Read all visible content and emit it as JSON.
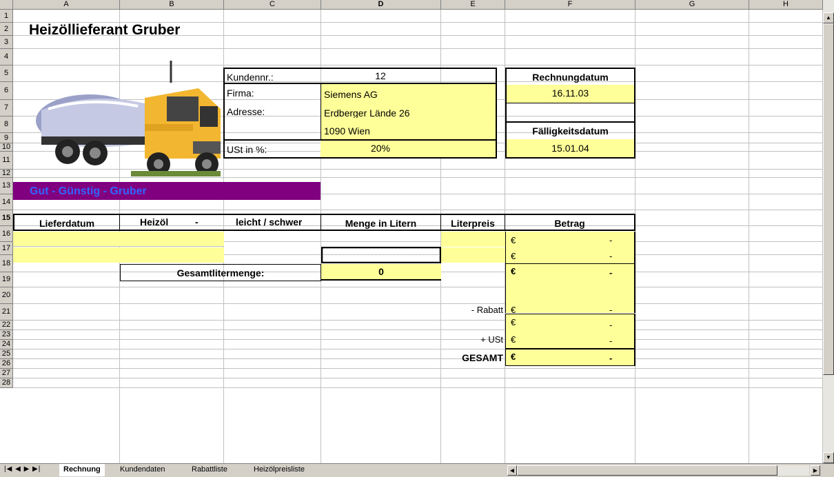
{
  "columns": [
    "A",
    "B",
    "C",
    "D",
    "E",
    "F",
    "G",
    "H"
  ],
  "rows": [
    "1",
    "2",
    "3",
    "4",
    "5",
    "6",
    "7",
    "8",
    "9",
    "10",
    "11",
    "12",
    "13",
    "14",
    "15",
    "16",
    "17",
    "18",
    "19",
    "20",
    "21",
    "22",
    "23",
    "24",
    "25",
    "26",
    "27",
    "28"
  ],
  "title": "Heizöllieferant Gruber",
  "slogan": "Gut - Günstig - Gruber",
  "customer": {
    "kundennr_label": "Kundennr.:",
    "kundennr_value": "12",
    "firma_label": "Firma:",
    "firma_value": "Siemens AG",
    "adresse_label": "Adresse:",
    "adresse_value1": "Erdberger Lände 26",
    "adresse_value2": "1090 Wien",
    "ust_label": "USt in %:",
    "ust_value": "20%"
  },
  "invoice": {
    "rechnungsdatum_label": "Rechnungdatum",
    "rechnungsdatum_value": "16.11.03",
    "faelligkeit_label": "Fälligkeitsdatum",
    "faelligkeit_value": "15.01.04"
  },
  "table": {
    "headers": {
      "lieferdatum": "Lieferdatum",
      "heizoel": "Heizöl",
      "dash": "-",
      "leicht": "leicht / schwer",
      "menge": "Menge in Litern",
      "literpreis": "Literpreis",
      "betrag": "Betrag"
    },
    "currency": "€",
    "dash": "-",
    "gesamtliter_label": "Gesamtlitermenge:",
    "gesamtliter_value": "0",
    "rabatt_label": "- Rabatt",
    "ust_label": "+ USt",
    "gesamt_label": "GESAMT"
  },
  "sheet_tabs": [
    "Rechnung",
    "Kundendaten",
    "Rabattliste",
    "Heizölpreisliste"
  ],
  "active_tab": "Rechnung",
  "colors": {
    "yellow_fill": "#ffff99",
    "slogan_bg": "#800080",
    "slogan_text": "#3366ff"
  },
  "icons": [
    "truck-image",
    "tab-first-icon",
    "tab-prev-icon",
    "tab-next-icon",
    "tab-last-icon",
    "scroll-up-icon",
    "scroll-down-icon"
  ]
}
